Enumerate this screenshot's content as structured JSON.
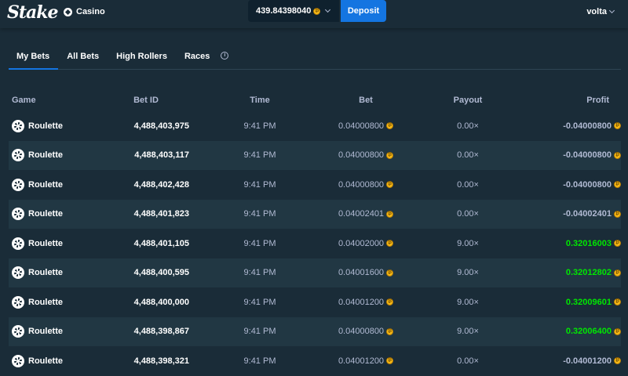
{
  "header": {
    "logo": "Stake",
    "casino_label": "Casino",
    "balance": "439.84398040",
    "deposit_label": "Deposit",
    "username": "volta"
  },
  "tabs": [
    {
      "label": "My Bets",
      "active": true
    },
    {
      "label": "All Bets"
    },
    {
      "label": "High Rollers"
    },
    {
      "label": "Races"
    }
  ],
  "table": {
    "columns": [
      "Game",
      "Bet ID",
      "Time",
      "Bet",
      "Payout",
      "Profit"
    ],
    "rows": [
      {
        "game": "Roulette",
        "bet_id": "4,488,403,975",
        "time": "9:41 PM",
        "bet": "0.04000800",
        "payout": "0.00×",
        "profit": "-0.04000800",
        "win": false
      },
      {
        "game": "Roulette",
        "bet_id": "4,488,403,117",
        "time": "9:41 PM",
        "bet": "0.04000800",
        "payout": "0.00×",
        "profit": "-0.04000800",
        "win": false
      },
      {
        "game": "Roulette",
        "bet_id": "4,488,402,428",
        "time": "9:41 PM",
        "bet": "0.04000800",
        "payout": "0.00×",
        "profit": "-0.04000800",
        "win": false
      },
      {
        "game": "Roulette",
        "bet_id": "4,488,401,823",
        "time": "9:41 PM",
        "bet": "0.04002401",
        "payout": "0.00×",
        "profit": "-0.04002401",
        "win": false
      },
      {
        "game": "Roulette",
        "bet_id": "4,488,401,105",
        "time": "9:41 PM",
        "bet": "0.04002000",
        "payout": "9.00×",
        "profit": "0.32016003",
        "win": true
      },
      {
        "game": "Roulette",
        "bet_id": "4,488,400,595",
        "time": "9:41 PM",
        "bet": "0.04001600",
        "payout": "9.00×",
        "profit": "0.32012802",
        "win": true
      },
      {
        "game": "Roulette",
        "bet_id": "4,488,400,000",
        "time": "9:41 PM",
        "bet": "0.04001200",
        "payout": "9.00×",
        "profit": "0.32009601",
        "win": true
      },
      {
        "game": "Roulette",
        "bet_id": "4,488,398,867",
        "time": "9:41 PM",
        "bet": "0.04000800",
        "payout": "9.00×",
        "profit": "0.32006400",
        "win": true
      },
      {
        "game": "Roulette",
        "bet_id": "4,488,398,321",
        "time": "9:41 PM",
        "bet": "0.04001200",
        "payout": "0.00×",
        "profit": "-0.04001200",
        "win": false
      }
    ]
  },
  "colors": {
    "background": "#1a2c38",
    "row_alt": "#213743",
    "accent_blue": "#1475e1",
    "win_green": "#00e701",
    "muted_text": "#b1bad3"
  }
}
